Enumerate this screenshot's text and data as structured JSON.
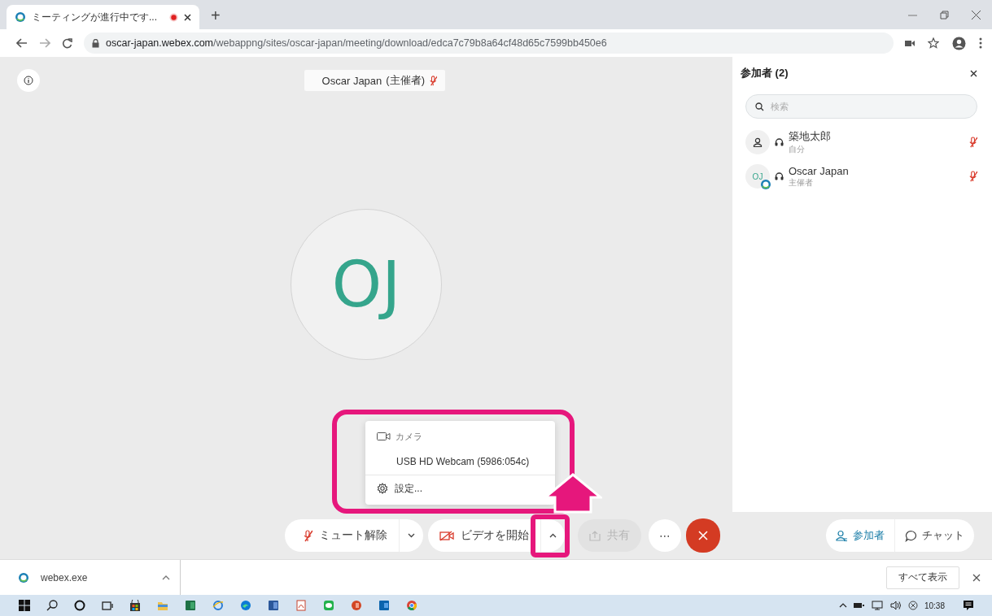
{
  "browser": {
    "tabs": [
      {
        "title": "ミーティングが進行中です...",
        "selected": true,
        "recording": true
      }
    ],
    "new_tab": "+",
    "url_host": "oscar-japan.webex.com",
    "url_path": "/webappng/sites/oscar-japan/meeting/download/edca7c79b8a64cf48d65c7599bb450e6"
  },
  "stage": {
    "speaker_name": "Oscar Japan",
    "speaker_role": "(主催者)",
    "speaker_muted": true,
    "avatar_initials": "OJ"
  },
  "camera_menu": {
    "header": "カメラ",
    "items": [
      {
        "kind": "device",
        "label": "USB HD Webcam (5986:054c)"
      },
      {
        "kind": "settings",
        "label": "設定..."
      }
    ]
  },
  "controls": [
    {
      "kind": "mute",
      "label": "ミュート解除",
      "disabled": false
    },
    {
      "kind": "video",
      "label": "ビデオを開始",
      "disabled": false
    },
    {
      "kind": "share",
      "label": "共有",
      "disabled": true
    },
    {
      "kind": "more",
      "label": "⋯",
      "disabled": false
    },
    {
      "kind": "end",
      "disabled": false
    }
  ],
  "panel_tabs": [
    {
      "label": "参加者",
      "selected": true
    },
    {
      "label": "チャット",
      "selected": false
    }
  ],
  "participants_panel": {
    "title": "参加者 (2)",
    "search": {
      "placeholder": "検索"
    },
    "participants": [
      {
        "kind": "person",
        "name": "築地太郎",
        "role": "自分",
        "muted": true
      },
      {
        "kind": "initials",
        "initials": "OJ",
        "name": "Oscar Japan",
        "role": "主催者",
        "muted": true
      }
    ]
  },
  "downloads": {
    "items": [
      {
        "filename": "webex.exe"
      }
    ],
    "show_all": "すべて表示"
  },
  "taskbar": {
    "clock": "10:38"
  }
}
